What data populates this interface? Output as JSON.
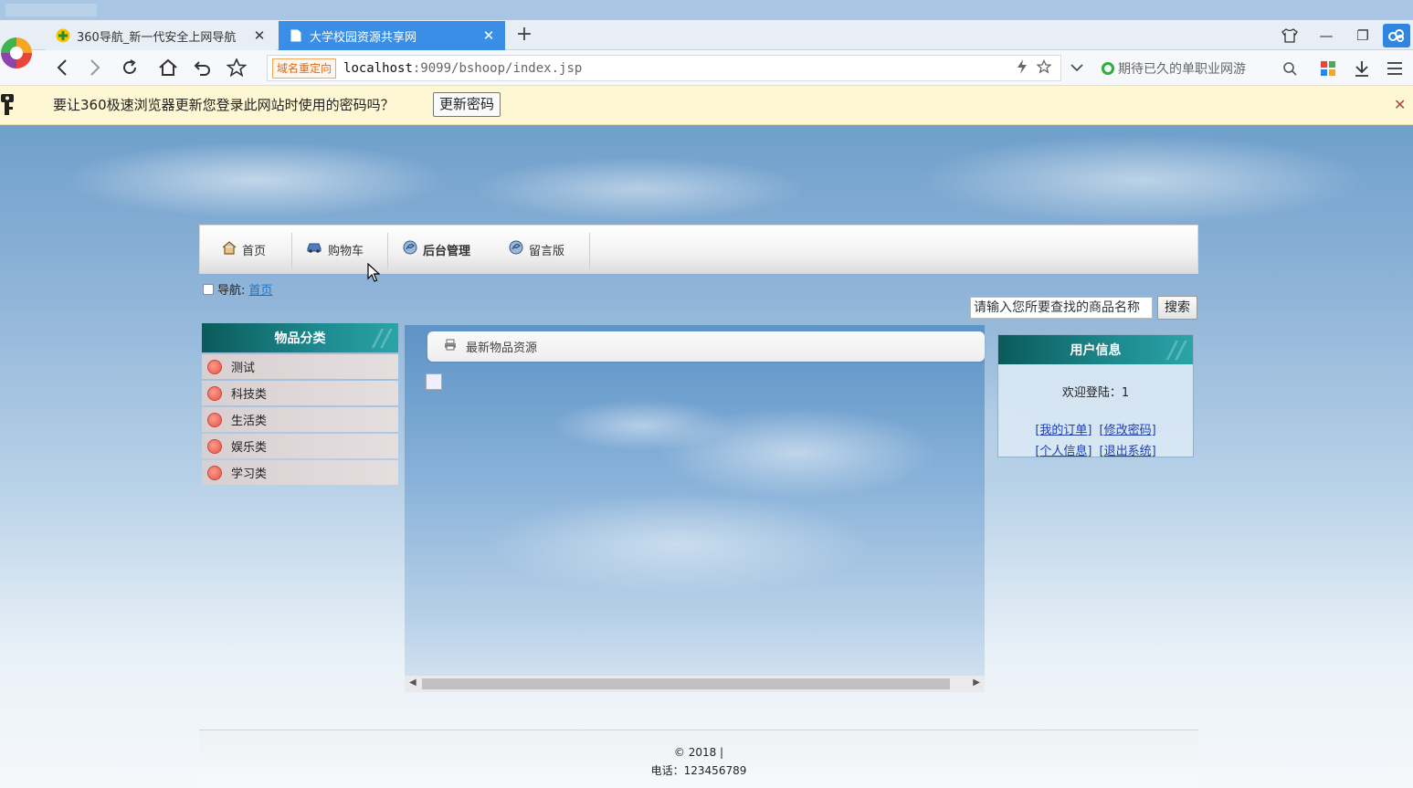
{
  "browser": {
    "tabs": [
      {
        "title": "360导航_新一代安全上网导航",
        "active": false
      },
      {
        "title": "大学校园资源共享网",
        "active": true
      }
    ],
    "address": {
      "redirect_label": "域名重定向",
      "host": "localhost",
      "path": ":9099/bshoop/index.jsp"
    },
    "search_suggestion": "期待已久的单职业网游",
    "password_bar": {
      "message": "要让360极速浏览器更新您登录此网站时使用的密码吗？",
      "button": "更新密码"
    },
    "colors": {
      "active_tab": "#3a8ee6",
      "accent": "#2f86e0"
    }
  },
  "nav": {
    "items": [
      {
        "label": "首页",
        "icon": "home-icon"
      },
      {
        "label": "购物车",
        "icon": "car-icon"
      },
      {
        "label": "后台管理",
        "icon": "swirl-icon"
      },
      {
        "label": "留言版",
        "icon": "swirl-icon"
      }
    ]
  },
  "breadcrumb": {
    "prefix": "导航:",
    "home": "首页"
  },
  "search": {
    "input_value": "请输入您所要查找的商品名称",
    "button": "搜索"
  },
  "categories": {
    "title": "物品分类",
    "items": [
      "测试",
      "科技类",
      "生活类",
      "娱乐类",
      "学习类"
    ]
  },
  "main": {
    "section_title": "最新物品资源"
  },
  "user": {
    "title": "用户信息",
    "welcome": "欢迎登陆：1",
    "links": [
      "[我的订单]",
      "[修改密码]",
      "[个人信息]",
      "[退出系统]"
    ]
  },
  "footer": {
    "copyright": "© 2018 |",
    "phone": "电话：123456789"
  }
}
